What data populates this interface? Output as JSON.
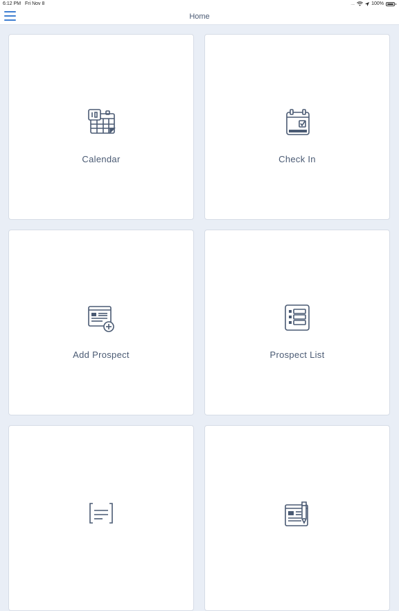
{
  "status_bar": {
    "time": "6:12 PM",
    "date": "Fri Nov 8",
    "signal": ".....",
    "battery": "100%"
  },
  "nav": {
    "title": "Home"
  },
  "tiles": [
    {
      "label": "Calendar",
      "icon": "calendar-icon"
    },
    {
      "label": "Check In",
      "icon": "check-in-icon"
    },
    {
      "label": "Add Prospect",
      "icon": "add-prospect-icon"
    },
    {
      "label": "Prospect List",
      "icon": "prospect-list-icon"
    },
    {
      "label": "",
      "icon": "notes-icon"
    },
    {
      "label": "",
      "icon": "report-icon"
    }
  ],
  "colors": {
    "accent": "#3f7fd1",
    "icon": "#4a5a73",
    "background": "#e9eef6",
    "tile": "#ffffff"
  }
}
